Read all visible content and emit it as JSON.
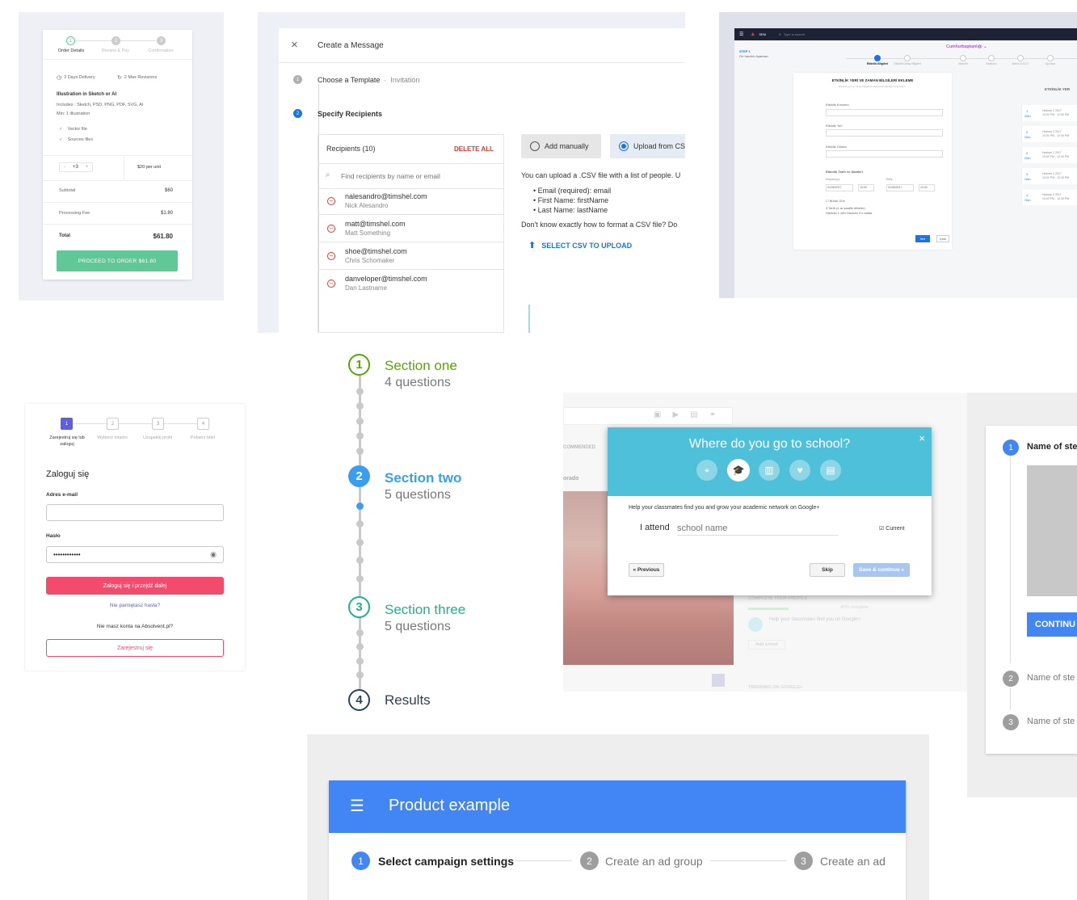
{
  "order": {
    "steps": [
      "Order Details",
      "Review & Pay",
      "Confirmation"
    ],
    "step_numbers": [
      "1",
      "2",
      "3"
    ],
    "delivery": "3 Days Delivery",
    "revisions": "2 Max Revisions",
    "title": "Illustration in Sketch or AI",
    "includes": "Includes : Sketch, PSD, PNG, PDF, SVG, AI",
    "min": "Min: 1 illustration",
    "features": [
      "Vector file",
      "Sources files"
    ],
    "qty_minus": "-",
    "qty_value": "+3",
    "qty_plus": "+",
    "unit_price": "$20 per unit",
    "subtotal_label": "Subtotal",
    "subtotal_value": "$60",
    "fee_label": "Processing Fee",
    "fee_value": "$1.80",
    "total_label": "Total",
    "total_value": "$61.80",
    "cta": "PROCEED TO ORDER $61.80",
    "accent": "#5fc896"
  },
  "message": {
    "title": "Create a Message",
    "step1_number": "1",
    "step1_label": "Choose a Template",
    "step1_sep": "·",
    "step1_value": "Invitation",
    "step2_number": "2",
    "step2_label": "Specify Recipients",
    "recipients_header": "Recipients (10)",
    "delete_all": "DELETE ALL",
    "search_placeholder": "Find recipients by name or email",
    "recipients": [
      {
        "email": "nalesandro@timshel.com",
        "name": "Nick Alesandro"
      },
      {
        "email": "matt@timshel.com",
        "name": "Matt Something"
      },
      {
        "email": "shoe@timshel.com",
        "name": "Chris Schomaker"
      },
      {
        "email": "danveloper@timshel.com",
        "name": "Dan Lastname"
      }
    ],
    "option_manual": "Add manually",
    "option_upload": "Upload from CS",
    "info": "You can upload a .CSV file with a list of people. U",
    "bullets": [
      "Email (required): email",
      "First Name: firstName",
      "Last Name: lastName"
    ],
    "help": "Don't know exactly how to format a CSV file? Do",
    "upload_link": "SELECT CSV TO UPLOAD",
    "accent": "#1a73e8"
  },
  "dashboard": {
    "brand": "SEM",
    "search": "Type to search",
    "breadcrumb": "Cumhurbaşkanlığı",
    "step_label": "STEP 1",
    "step_sub": "Ön hazırlık Aşaması",
    "tabs": [
      "Etkinlik Bilgileri",
      "Etkinlik Detay Bilgileri",
      "İdareler",
      "Katılımcı",
      "Basın & UCV",
      "Sponsor"
    ],
    "card_title": "ETKİNLİK YERİ VE ZAMAN BİLGİLERİ EKLEME",
    "card_sub": "Etkinlik yeri ve zaman bilgilerini ekleyerek etkinliği tamamlayın.",
    "fields": [
      "Etkinlik Konumu",
      "Etkinlik Yeri",
      "Etkinlik Ortamı"
    ],
    "date_section": "Etkinlik Tarih ve Saatleri",
    "start": "Başlangıç",
    "end": "Bitiş",
    "start_date": "01/06/2017",
    "start_time": "10:00",
    "end_date": "01/06/2017",
    "end_time": "10:00",
    "allday": "Bütün Gün",
    "note1": "3 Tarih (4 ar saatlik dilimler)",
    "note2": "Haziran 1 den Haziran 3 e kadar",
    "save": "İleri",
    "cancel": "İptal",
    "right_title": "ETKİNLİK YER",
    "right_items": [
      {
        "day": "1",
        "date": "Haziran 2 2017",
        "time": "10:00 PM - 12:30 PM"
      },
      {
        "day": "2",
        "date": "Haziran 2 2017",
        "time": "10:00 PM - 12:30 PM"
      },
      {
        "day": "2",
        "date": "Haziran 2 2017",
        "time": "10:00 PM - 12:30 PM"
      },
      {
        "day": "3",
        "date": "Haziran 2 2017",
        "time": "10:00 PM - 12:30 PM"
      },
      {
        "day": "4",
        "date": "Haziran 2 2017",
        "time": "10:00 PM - 12:30 PM"
      }
    ],
    "day_word": "Gün"
  },
  "login": {
    "steps": [
      "Zarejestruj się lub zaloguj",
      "Wybierz miasto",
      "Uzupełnij profil",
      "Pobierz bilet"
    ],
    "step_numbers": [
      "1",
      "2",
      "3",
      "4"
    ],
    "heading": "Zaloguj się",
    "email_label": "Adres e-mail",
    "password_label": "Hasło",
    "password_value": "••••••••••••",
    "submit": "Zaloguj się i przejdź dalej",
    "forgot": "Nie pamiętasz hasła?",
    "no_account": "Nie masz konta na Absolvent.pl?",
    "register": "Zarejestruj się",
    "accent": "#f44a6b"
  },
  "vertical": {
    "sections": [
      {
        "number": "1",
        "title": "Section one",
        "subtitle": "4 questions",
        "color": "#5aa500"
      },
      {
        "number": "2",
        "title": "Section two",
        "subtitle": "5 questions",
        "color": "#3a9ef0"
      },
      {
        "number": "3",
        "title": "Section three",
        "subtitle": "5 questions",
        "color": "#1fb08c"
      },
      {
        "number": "4",
        "title": "Results",
        "subtitle": "",
        "color": "#2b4258"
      }
    ]
  },
  "gplus": {
    "title": "Where do you go to school?",
    "close": "×",
    "help": "Help your classmates find you and grow your academic network on Google+",
    "attend": "I attend",
    "school_placeholder": "school name",
    "current": "Current",
    "prev": "« Previous",
    "skip": "Skip",
    "save": "Save & continue »",
    "bg_recommended": "COMMENDED",
    "bg_place": "orado",
    "bg_complete": "COMPLETE YOUR PROFILE",
    "bg_percent": "40% complete",
    "bg_help": "Help your classmates find you on Google+.",
    "bg_add": "Add school",
    "bg_trending": "TRENDING ON GOOGLE+"
  },
  "rightstep": {
    "steps": [
      {
        "number": "1",
        "label": "Name of ste"
      },
      {
        "number": "2",
        "label": "Name of ste"
      },
      {
        "number": "3",
        "label": "Name of ste"
      }
    ],
    "cta": "CONTINU"
  },
  "product": {
    "title": "Product example",
    "steps": [
      {
        "number": "1",
        "label": "Select campaign settings"
      },
      {
        "number": "2",
        "label": "Create an ad group"
      },
      {
        "number": "3",
        "label": "Create an ad"
      }
    ],
    "accent": "#4285f4"
  }
}
